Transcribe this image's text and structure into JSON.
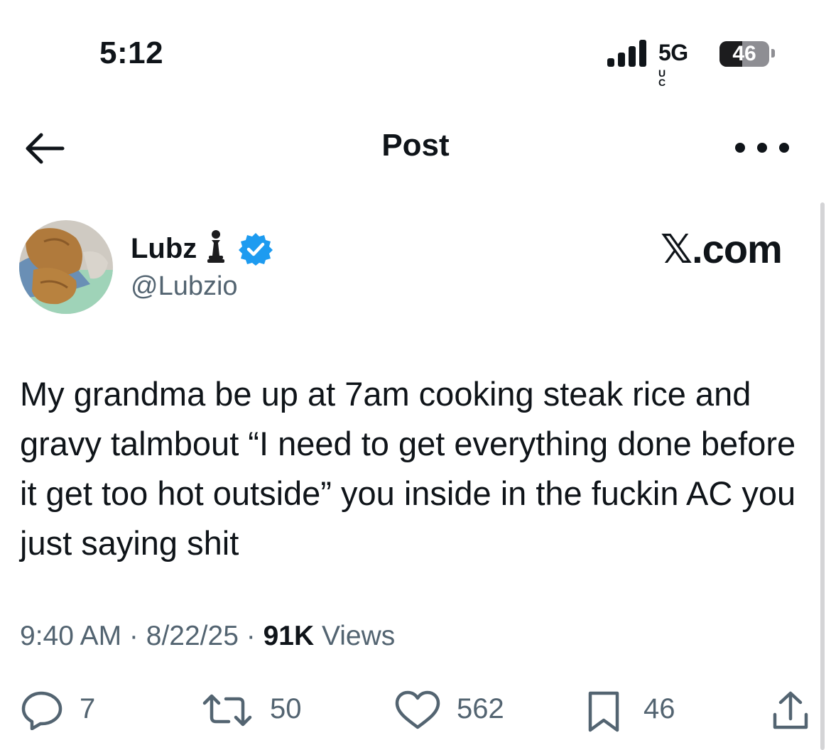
{
  "status_bar": {
    "time": "5:12",
    "network": "5G",
    "network_suffix": "UC",
    "battery": "46",
    "battery_level": 0.46
  },
  "nav": {
    "title": "Post"
  },
  "author": {
    "display_name": "Lubz",
    "handle": "@Lubzio",
    "badge_emoji": "chess-pawn-icon",
    "verified": true
  },
  "brand": {
    "watermark": "𝕏.com"
  },
  "post": {
    "text": "My grandma be up at 7am cooking steak rice and gravy talmbout “I need to get everything done before it get too hot outside” you inside in the fuckin AC you just saying shit",
    "time": "9:40 AM",
    "date": "8/22/25",
    "views_count": "91K",
    "views_label": "Views"
  },
  "actions": {
    "replies": "7",
    "reposts": "50",
    "likes": "562",
    "bookmarks": "46"
  },
  "colors": {
    "text": "#0f1419",
    "secondary": "#536471",
    "verified": "#1d9bf0"
  }
}
